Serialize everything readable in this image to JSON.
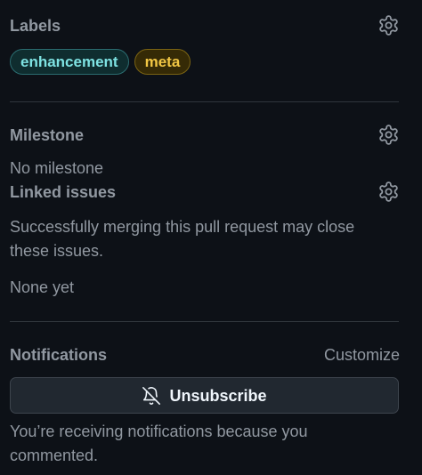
{
  "labels_section": {
    "title": "Labels",
    "labels": [
      {
        "name": "enhancement",
        "color": "#7ee2e2",
        "bg": "#0f2d2f",
        "border": "#2b6c70"
      },
      {
        "name": "meta",
        "color": "#f2c744",
        "bg": "#352a06",
        "border": "#7a6313"
      }
    ]
  },
  "milestone_section": {
    "title": "Milestone",
    "value": "No milestone"
  },
  "linked_issues_section": {
    "title": "Linked issues",
    "description": "Successfully merging this pull request may close these issues.",
    "value": "None yet"
  },
  "notifications_section": {
    "title": "Notifications",
    "customize_label": "Customize",
    "button_label": "Unsubscribe",
    "button_icon": "bell-slash-icon",
    "status_text": "You’re receiving notifications because you commented."
  },
  "colors": {
    "background": "#0d1117",
    "muted_text": "#9198a1",
    "divider": "#30363d",
    "button_bg": "#212830"
  }
}
